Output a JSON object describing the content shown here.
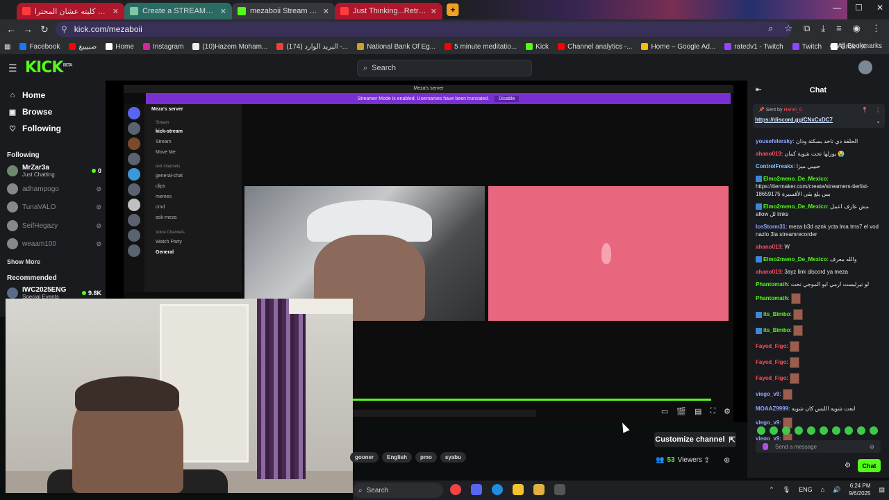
{
  "browser": {
    "tabs": [
      {
        "title": "تصدق إيه راح كليته عشان المحترا",
        "favicon": "youtube-icon",
        "color": "#b0172c"
      },
      {
        "title": "Create a STREAMERS TIERLIST",
        "favicon": "tiermaker-icon",
        "color": "#2a6b63"
      },
      {
        "title": "mezaboii Stream - Watch Live o",
        "favicon": "kick-icon",
        "color": "#36383d"
      },
      {
        "title": "Just Thinking...Retro Jazz - V",
        "favicon": "youtube-icon",
        "color": "#b0172c"
      }
    ],
    "new_tab": "+",
    "url": "kick.com/mezaboii",
    "bookmarks": [
      {
        "label": "Facebook",
        "icon": "facebook-icon",
        "color": "#1877f2"
      },
      {
        "label": "صبيييغ",
        "icon": "youtube-icon",
        "color": "#ff0000"
      },
      {
        "label": "Home",
        "icon": "x-icon",
        "color": "#ffffff"
      },
      {
        "label": "Instagram",
        "icon": "instagram-icon",
        "color": "#d6249f"
      },
      {
        "label": "(10)Hazem Moham...",
        "icon": "tiktok-icon",
        "color": "#eeeeee"
      },
      {
        "label": "(174) البريد الوارد -...",
        "icon": "gmail-icon",
        "color": "#ea4335"
      },
      {
        "label": "National Bank Of Eg...",
        "icon": "bank-icon",
        "color": "#c9a227"
      },
      {
        "label": "5 minute meditatio...",
        "icon": "youtube-icon",
        "color": "#ff0000"
      },
      {
        "label": "Kick",
        "icon": "kick-icon",
        "color": "#53fc18"
      },
      {
        "label": "Channel analytics -...",
        "icon": "youtube-icon",
        "color": "#ff0000"
      },
      {
        "label": "Home – Google Ad...",
        "icon": "google-ads-icon",
        "color": "#fbbc04"
      },
      {
        "label": "ratedv1 - Twitch",
        "icon": "twitch-icon",
        "color": "#9146ff"
      },
      {
        "label": "Twitch",
        "icon": "twitch-icon",
        "color": "#9146ff"
      },
      {
        "label": "Grok / X",
        "icon": "x-icon",
        "color": "#ffffff"
      }
    ],
    "all_bookmarks": "All Bookmarks"
  },
  "kick": {
    "logo": "KICK",
    "logo_badge": "BETA",
    "search_placeholder": "Search",
    "accent": "#53fc18",
    "nav": [
      {
        "label": "Home",
        "icon": "home-icon"
      },
      {
        "label": "Browse",
        "icon": "browse-icon"
      },
      {
        "label": "Following",
        "icon": "heart-icon"
      }
    ],
    "following_title": "Following",
    "following": [
      {
        "name": "MrZar3a",
        "sub": "Just Chatting",
        "viewers": "0",
        "live": true
      },
      {
        "name": "adhampogo",
        "live": false
      },
      {
        "name": "TunaVALO",
        "live": false
      },
      {
        "name": "SeifHegazy",
        "live": false
      },
      {
        "name": "weaam100",
        "live": false
      }
    ],
    "show_more": "Show More",
    "recommended_title": "Recommended",
    "recommended": [
      {
        "name": "IWC2025ENG",
        "sub": "Special Events",
        "viewers": "9.8K"
      }
    ]
  },
  "stream": {
    "discord_title": "Meza's server",
    "streamer_mode_text": "Streamer Mode is enabled. Usernames have been truncated.",
    "streamer_mode_btn": "Disable",
    "server_name": "Meza's server",
    "channels": [
      {
        "label": "Stream",
        "type": "header"
      },
      {
        "label": "kick-stream",
        "type": "bold"
      },
      {
        "label": "Stream",
        "type": "normal"
      },
      {
        "label": "Move Me",
        "type": "normal"
      },
      {
        "label": "text channels",
        "type": "header"
      },
      {
        "label": "general-chat",
        "type": "normal"
      },
      {
        "label": "clips",
        "type": "normal"
      },
      {
        "label": "memes",
        "type": "normal"
      },
      {
        "label": "cmd",
        "type": "normal"
      },
      {
        "label": "ask-meza",
        "type": "normal"
      },
      {
        "label": "Voice Channels",
        "type": "header"
      },
      {
        "label": "Watch Party",
        "type": "normal"
      },
      {
        "label": "General",
        "type": "bold"
      }
    ],
    "progress": 1.0
  },
  "channel_info": {
    "customize_label": "Customize channel",
    "viewers": "53",
    "viewers_label": "Viewers",
    "tags": [
      "gooner",
      "English",
      "pmo",
      "syabu"
    ]
  },
  "chat": {
    "title": "Chat",
    "pinned_sent_by": "Sent by",
    "pinned_user": "Ham0_0",
    "pinned_link": "https://discord.gg/CNxCxDC7",
    "messages": [
      {
        "user": "yousefeleraky",
        "color": "#8fa8ff",
        "text": "الحلقة دي تاخد بسكتة ودان"
      },
      {
        "user": "ahano019",
        "color": "#ff4d5e",
        "text": "يوزلها تحت شوية كمان 😭"
      },
      {
        "user": "ControlFreakx",
        "color": "#7ec8ff",
        "text": "حبيبي ميزا"
      },
      {
        "user": "Elmo2meno_De_Mexico",
        "color": "#53fc18",
        "badge": true,
        "text": "https://tiermaker.com/create/streamers-tierlist-18659175 بس بلغ بقى الأقسيرة"
      },
      {
        "user": "Elmo2meno_De_Mexico",
        "color": "#53fc18",
        "badge": true,
        "text": "مش عارف اعمل allow لل links"
      },
      {
        "user": "IceStorm31",
        "color": "#8fa8ff",
        "text": "meza b3d aznk ycta lma tms7 el vod nazlo 3la streamrecorder"
      },
      {
        "user": "ahano019",
        "color": "#ff4d5e",
        "text": "W"
      },
      {
        "user": "Elmo2meno_De_Mexico",
        "color": "#53fc18",
        "badge": true,
        "text": "والله معرف"
      },
      {
        "user": "ahano019",
        "color": "#ff4d5e",
        "text": "3ayz link discord ya meza"
      },
      {
        "user": "Phantomath",
        "color": "#53fc18",
        "text": "لو تيرليست ارمي ابو الموجي تحت"
      },
      {
        "user": "Phantomath",
        "color": "#53fc18",
        "emote": true
      },
      {
        "user": "its_Bimbo",
        "color": "#53fc18",
        "badge": true,
        "emote": true
      },
      {
        "user": "its_Bimbo",
        "color": "#53fc18",
        "badge": true,
        "emote": true
      },
      {
        "user": "Fayed_Figo",
        "color": "#ff4d5e",
        "emote": true
      },
      {
        "user": "Fayed_Figo",
        "color": "#ff4d5e",
        "emote": true
      },
      {
        "user": "Fayed_Figo",
        "color": "#ff4d5e",
        "emote": true
      },
      {
        "user": "viego_v9",
        "color": "#8fa8ff",
        "emote": true
      },
      {
        "user": "MOAAZ9999",
        "color": "#8fa8ff",
        "text": "ابعت شويه اللبس كان شويه"
      },
      {
        "user": "viego_v9",
        "color": "#8fa8ff",
        "emote": true
      },
      {
        "user": "viego_v9",
        "color": "#8fa8ff",
        "emote": true
      }
    ],
    "input_placeholder": "Send a message",
    "send_label": "Chat"
  },
  "taskbar": {
    "search_placeholder": "Search",
    "lang": "ENG",
    "time": "6:24 PM",
    "date": "9/6/2025"
  }
}
